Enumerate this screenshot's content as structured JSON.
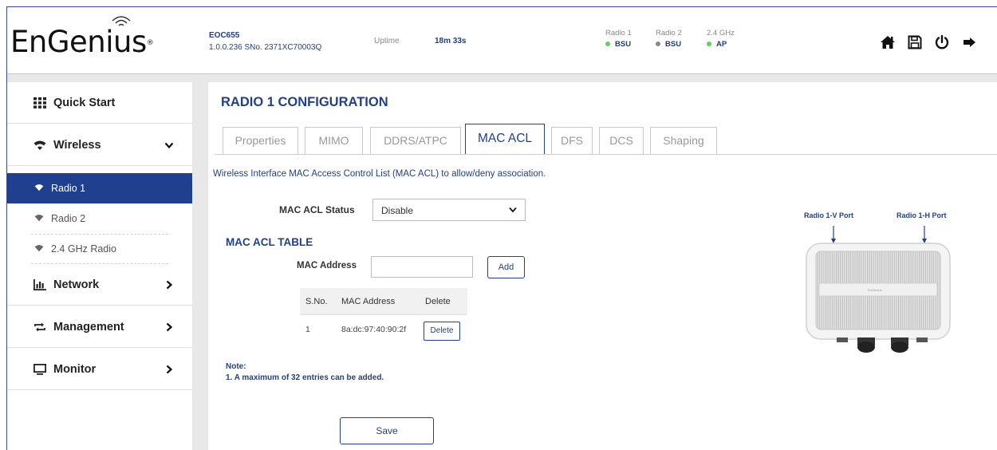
{
  "header": {
    "logo_text": "EnGenius",
    "logo_mark": "®",
    "device_model": "EOC655",
    "device_info": "1.0.0.236 SNo. 2371XC70003Q",
    "uptime_label": "Uptime",
    "uptime_value": "18m 33s",
    "radios": [
      {
        "label": "Radio 1",
        "value": "BSU",
        "color": "#5fd35f"
      },
      {
        "label": "Radio 2",
        "value": "BSU",
        "color": "#8a8a8a"
      },
      {
        "label": "2.4 GHz",
        "value": "AP",
        "color": "#5fd35f"
      }
    ],
    "icons": [
      "home-icon",
      "save-icon",
      "power-icon",
      "logout-icon"
    ]
  },
  "sidebar": {
    "items": [
      {
        "label": "Quick Start",
        "icon": "grid-icon"
      },
      {
        "label": "Wireless",
        "icon": "wifi-icon",
        "expanded": true
      },
      {
        "label": "Network",
        "icon": "bar-chart-icon"
      },
      {
        "label": "Management",
        "icon": "sync-icon"
      },
      {
        "label": "Monitor",
        "icon": "monitor-icon"
      }
    ],
    "subitems": [
      {
        "label": "Radio 1",
        "active": true
      },
      {
        "label": "Radio 2",
        "active": false
      },
      {
        "label": "2.4 GHz Radio",
        "active": false
      }
    ]
  },
  "main": {
    "title": "RADIO 1 CONFIGURATION",
    "tabs": [
      {
        "label": "Properties"
      },
      {
        "label": "MIMO"
      },
      {
        "label": "DDRS/ATPC"
      },
      {
        "label": "MAC ACL",
        "active": true
      },
      {
        "label": "DFS"
      },
      {
        "label": "DCS"
      },
      {
        "label": "Shaping"
      }
    ],
    "description": "Wireless Interface MAC Access Control List (MAC ACL) to allow/deny association.",
    "status_label": "MAC ACL Status",
    "status_value": "Disable",
    "table_title": "MAC ACL TABLE",
    "mac_label": "MAC Address",
    "mac_value": "",
    "add_label": "Add",
    "table": {
      "headers": [
        "S.No.",
        "MAC Address",
        "Delete"
      ],
      "rows": [
        {
          "sno": "1",
          "mac": "8a:dc:97:40:90:2f",
          "action": "Delete"
        }
      ]
    },
    "note_title": "Note:",
    "note_text": "1. A maximum of 32 entries can be added.",
    "save_label": "Save"
  },
  "device": {
    "port_v": "Radio 1-V Port",
    "port_h": "Radio 1-H Port",
    "brand": "EnGenius"
  },
  "colors": {
    "accent": "#213f8f",
    "online": "#5fd35f",
    "offline": "#8a8a8a"
  }
}
